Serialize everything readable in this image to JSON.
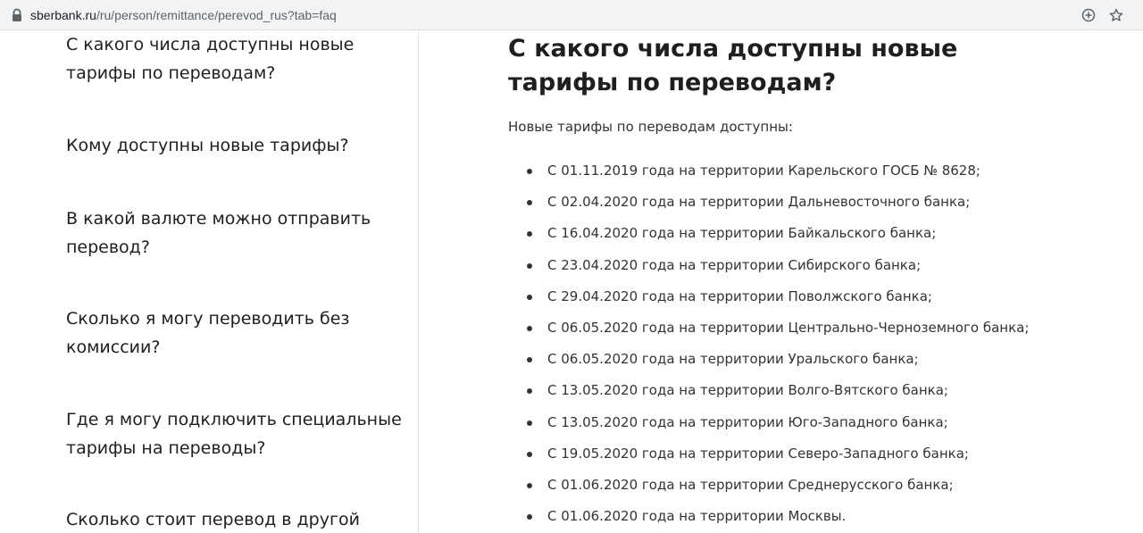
{
  "browser": {
    "url_domain": "sberbank.ru",
    "url_path": "/ru/person/remittance/perevod_rus?tab=faq",
    "icons": [
      "lock-icon",
      "add-icon",
      "star-icon"
    ]
  },
  "sidebar": {
    "items": [
      {
        "label": "С какого числа доступны новые тарифы по переводам?"
      },
      {
        "label": "Кому доступны новые тарифы?"
      },
      {
        "label": "В какой валюте можно отправить перевод?"
      },
      {
        "label": "Сколько я могу переводить без комиссии?"
      },
      {
        "label": "Где я могу подключить специальные тарифы на переводы?"
      },
      {
        "label": "Сколько стоит перевод в другой"
      }
    ]
  },
  "article": {
    "title": "С какого числа доступны новые тарифы по переводам?",
    "intro": "Новые тарифы по переводам доступны:",
    "items": [
      "С 01.11.2019 года на территории Карельского ГОСБ № 8628;",
      "С 02.04.2020 года на территории Дальневосточного банка;",
      "С 16.04.2020 года на территории Байкальского банка;",
      "С 23.04.2020 года на территории Сибирского банка;",
      "С 29.04.2020 года на территории Поволжского банка;",
      "С 06.05.2020 года на территории Центрально-Черноземного банка;",
      "С 06.05.2020 года на территории Уральского банка;",
      "С 13.05.2020 года на территории Волго-Вятского банка;",
      "С 13.05.2020 года на территории Юго-Западного банка;",
      "С 19.05.2020 года на территории Северо-Западного банка;",
      "С 01.06.2020 года на территории Среднерусского банка;",
      "С 01.06.2020 года на территории Москвы."
    ]
  }
}
